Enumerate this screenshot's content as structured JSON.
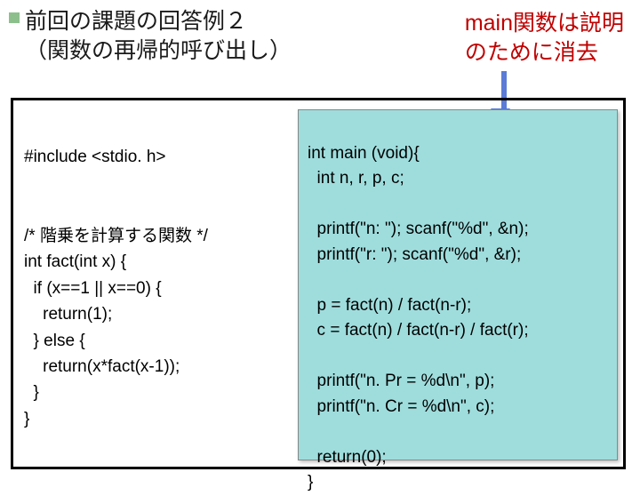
{
  "header": {
    "title_line1": "前回の課題の回答例２",
    "title_line2": "（関数の再帰的呼び出し）",
    "note_line1": "main関数は説明",
    "note_line2": "のために消去"
  },
  "code_left": {
    "l1": "#include <stdio. h>",
    "l2": "",
    "l3": "/* 階乗を計算する関数 */",
    "l4": "int fact(int x) {",
    "l5": "  if (x==1 || x==0) {",
    "l6": "    return(1);",
    "l7": "  } else {",
    "l8": "    return(x*fact(x-1));",
    "l9": "  }",
    "l10": "}"
  },
  "code_right": {
    "l1": "int main (void){",
    "l2": "  int n, r, p, c;",
    "l3": "",
    "l4": "  printf(\"n: \"); scanf(\"%d\", &n);",
    "l5": "  printf(\"r: \"); scanf(\"%d\", &r);",
    "l6": "",
    "l7": "  p = fact(n) / fact(n-r);",
    "l8": "  c = fact(n) / fact(n-r) / fact(r);",
    "l9": "",
    "l10": "  printf(\"n. Pr = %d\\n\", p);",
    "l11": "  printf(\"n. Cr = %d\\n\", c);",
    "l12": "",
    "l13": "  return(0);",
    "l14": "}"
  }
}
